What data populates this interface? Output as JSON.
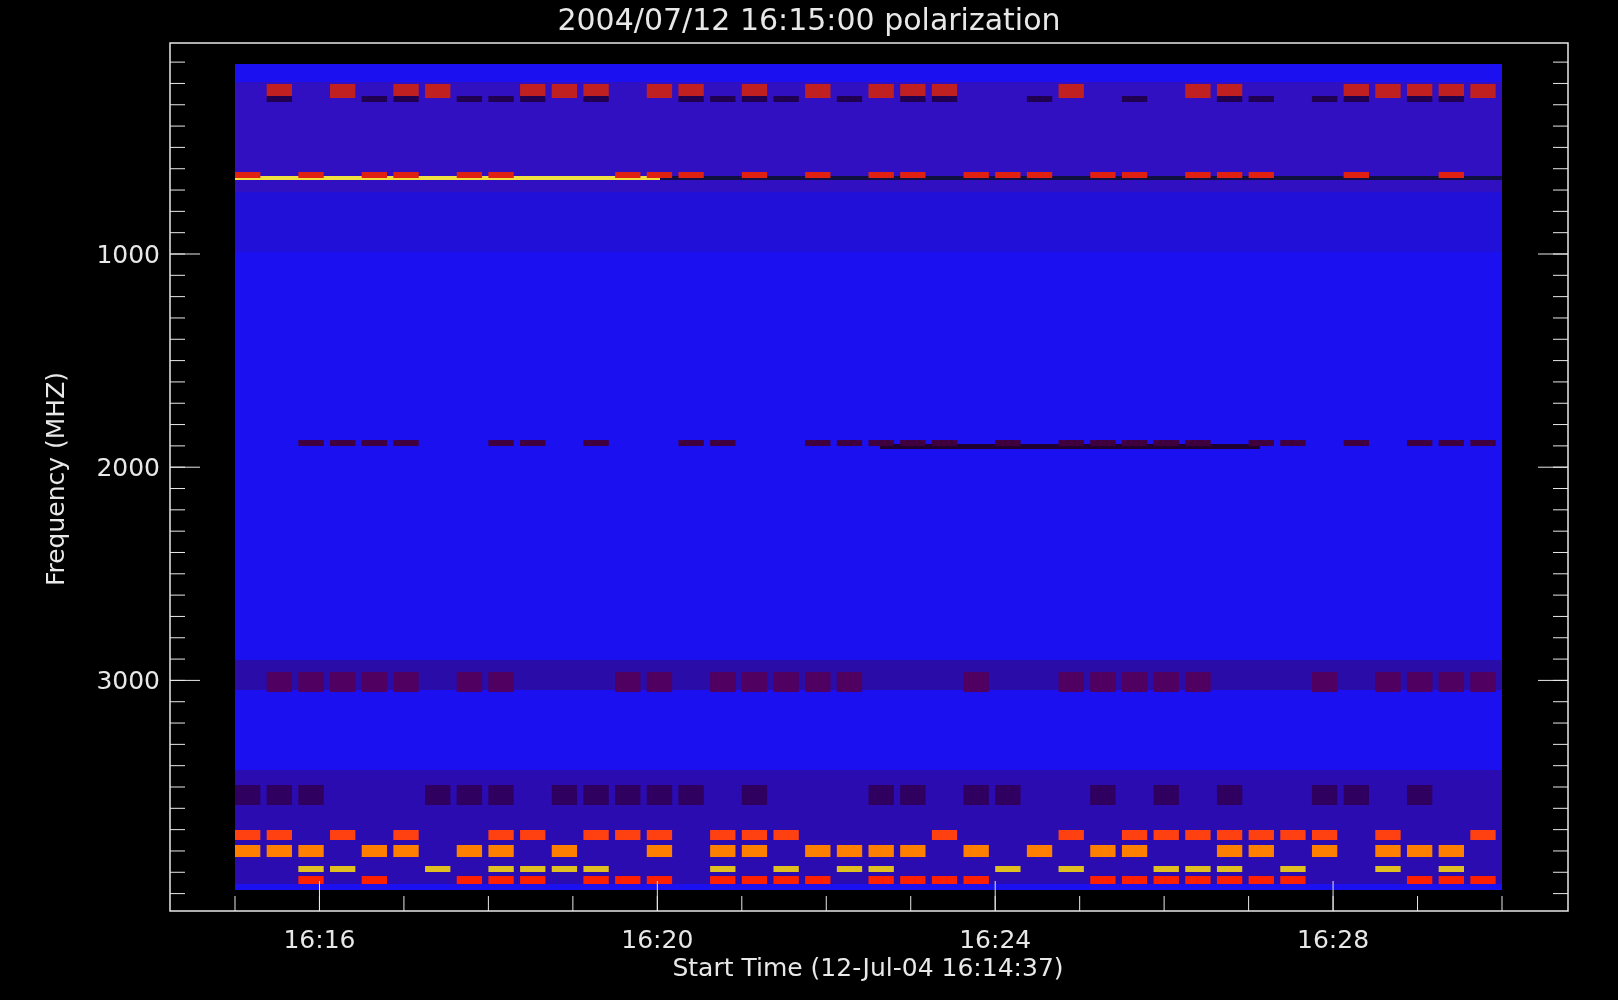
{
  "title": "2004/07/12 16:15:00 polarization",
  "y_axis": {
    "label": "Frequency (MHZ)",
    "ticks": [
      "1000",
      "2000",
      "3000"
    ]
  },
  "x_axis": {
    "label": "Start Time (12-Jul-04 16:14:37)",
    "ticks": [
      "16:16",
      "16:20",
      "16:24",
      "16:28"
    ]
  }
}
